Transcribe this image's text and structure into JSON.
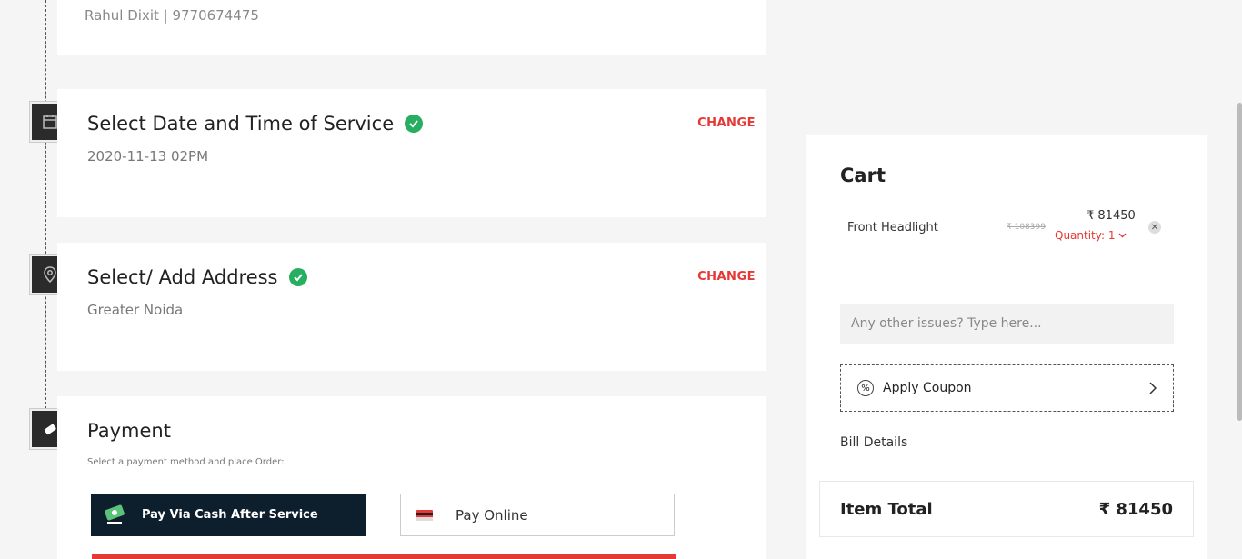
{
  "contact": {
    "text": "Rahul Dixit | 9770674475"
  },
  "date_step": {
    "title": "Select Date and Time of Service",
    "value": "2020-11-13 02PM",
    "change_label": "CHANGE",
    "icon": "calendar-icon"
  },
  "address_step": {
    "title": "Select/ Add Address",
    "value": "Greater Noida",
    "change_label": "CHANGE",
    "icon": "location-pin-icon"
  },
  "payment_step": {
    "title": "Payment",
    "hint": "Select a payment method and place Order:",
    "icon": "ticket-icon",
    "options": {
      "cash_label": "Pay Via Cash After Service",
      "online_label": "Pay Online"
    }
  },
  "cart": {
    "title": "Cart",
    "item": {
      "name": "Front Headlight",
      "old_price": "₹ 108399",
      "price": "₹ 81450",
      "quantity_label": "Quantity: 1"
    },
    "issues_placeholder": "Any other issues? Type here...",
    "coupon_label": "Apply Coupon",
    "bill_details_label": "Bill Details",
    "item_total_label": "Item Total",
    "item_total_value": "₹ 81450"
  },
  "colors": {
    "accent_red": "#e53935",
    "success_green": "#27ae60",
    "dark_navy": "#0d1e2d"
  }
}
